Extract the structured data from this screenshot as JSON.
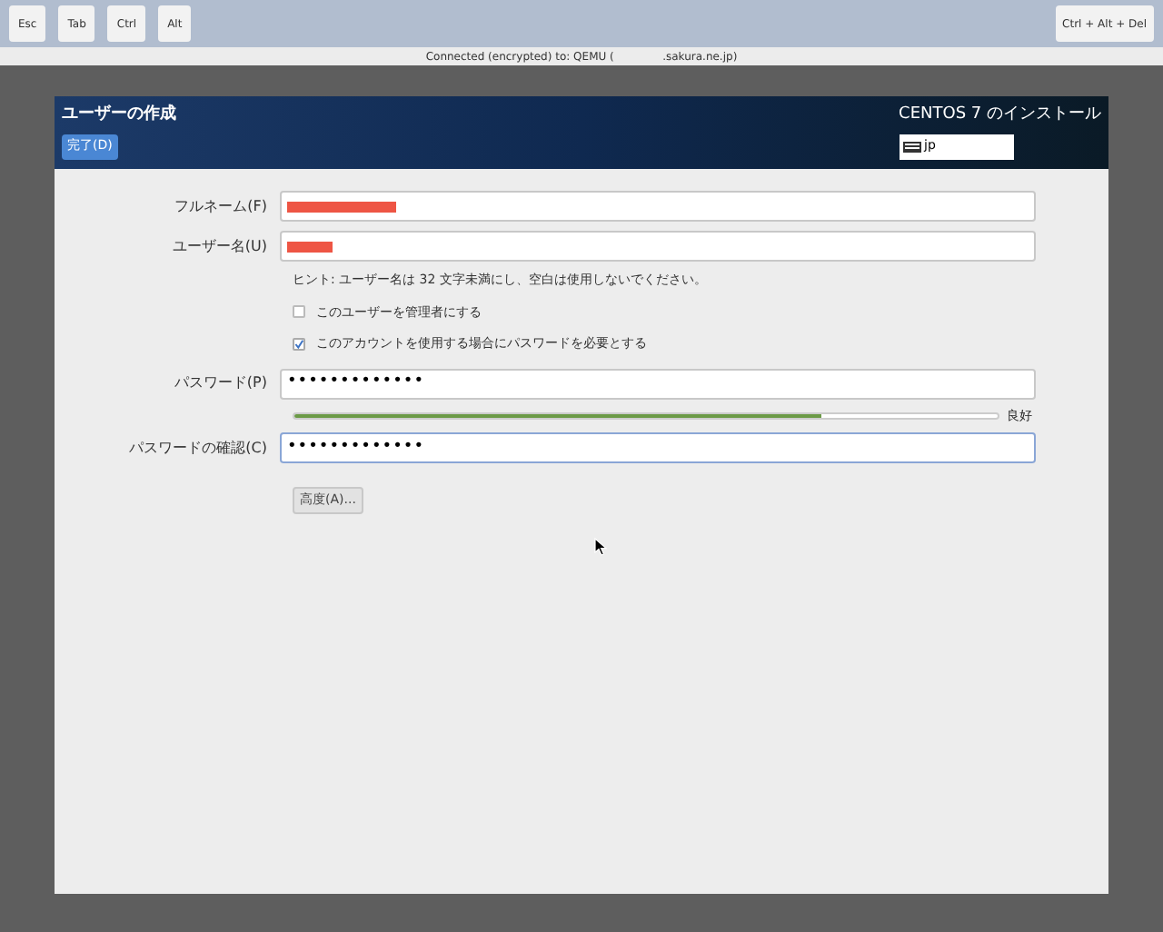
{
  "toolbar": {
    "keys": [
      "Esc",
      "Tab",
      "Ctrl",
      "Alt"
    ],
    "combo_key": "Ctrl + Alt + Del"
  },
  "status": "Connected (encrypted) to: QEMU (              .sakura.ne.jp)",
  "header": {
    "title": "ユーザーの作成",
    "done_button": "完了(D)",
    "product": "CENTOS 7 のインストール",
    "keyboard_layout": "jp"
  },
  "form": {
    "fullname": {
      "label": "フルネーム(F)",
      "redacted": true
    },
    "username": {
      "label": "ユーザー名(U)",
      "redacted": true
    },
    "hint": "ヒント: ユーザー名は 32 文字未満にし、空白は使用しないでください。",
    "options": [
      {
        "label": "このユーザーを管理者にする",
        "checked": false
      },
      {
        "label": "このアカウントを使用する場合にパスワードを必要とする",
        "checked": true
      }
    ],
    "password": {
      "label": "パスワード(P)",
      "value": "•••••••••••••"
    },
    "strength": {
      "level": 0.75,
      "reading": "良好"
    },
    "confirm": {
      "label": "パスワードの確認(C)",
      "value": "•••••••••••••",
      "focused": true
    },
    "advanced_button": "高度(A)..."
  }
}
